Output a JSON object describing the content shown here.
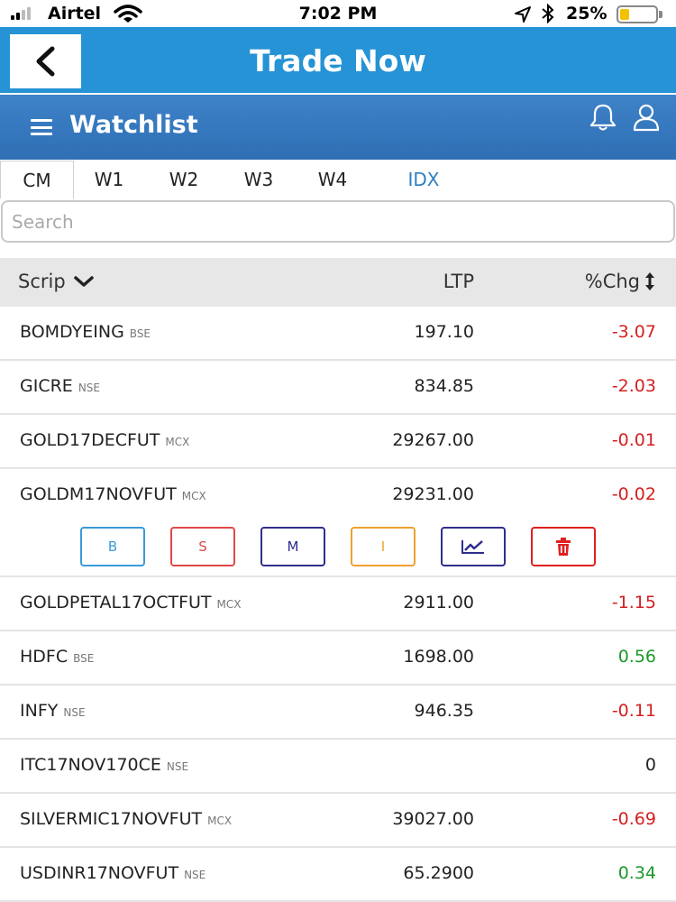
{
  "status_bar": {
    "carrier": "Airtel",
    "time": "7:02 PM",
    "battery": "25%",
    "battery_level": 0.25,
    "icons": [
      "signal-icon",
      "wifi-icon",
      "location-arrow-icon",
      "bluetooth-icon",
      "battery-icon"
    ]
  },
  "header": {
    "title": "Trade Now",
    "back_icon": "chevron-left-icon"
  },
  "watchlist_bar": {
    "title": "Watchlist",
    "icons": [
      "menu-icon",
      "bell-icon",
      "user-icon"
    ]
  },
  "tabs": [
    {
      "label": "CM",
      "active": true
    },
    {
      "label": "W1",
      "active": false
    },
    {
      "label": "W2",
      "active": false
    },
    {
      "label": "W3",
      "active": false
    },
    {
      "label": "W4",
      "active": false
    },
    {
      "label": "IDX",
      "active": false
    }
  ],
  "search": {
    "placeholder": "Search",
    "value": ""
  },
  "table": {
    "columns": {
      "scrip": "Scrip",
      "ltp": "LTP",
      "chg": "%Chg"
    },
    "rows": [
      {
        "scrip": "BOMDYEING",
        "exchange": "BSE",
        "ltp": "197.10",
        "chg": "-3.07"
      },
      {
        "scrip": "GICRE",
        "exchange": "NSE",
        "ltp": "834.85",
        "chg": "-2.03"
      },
      {
        "scrip": "GOLD17DECFUT",
        "exchange": "MCX",
        "ltp": "29267.00",
        "chg": "-0.01"
      },
      {
        "scrip": "GOLDM17NOVFUT",
        "exchange": "MCX",
        "ltp": "29231.00",
        "chg": "-0.02"
      },
      {
        "scrip": "GOLDPETAL17OCTFUT",
        "exchange": "MCX",
        "ltp": "2911.00",
        "chg": "-1.15"
      },
      {
        "scrip": "HDFC",
        "exchange": "BSE",
        "ltp": "1698.00",
        "chg": "0.56"
      },
      {
        "scrip": "INFY",
        "exchange": "NSE",
        "ltp": "946.35",
        "chg": "-0.11"
      },
      {
        "scrip": "ITC17NOV170CE",
        "exchange": "NSE",
        "ltp": "",
        "chg": "0"
      },
      {
        "scrip": "SILVERMIC17NOVFUT",
        "exchange": "MCX",
        "ltp": "39027.00",
        "chg": "-0.69"
      },
      {
        "scrip": "USDINR17NOVFUT",
        "exchange": "NSE",
        "ltp": "65.2900",
        "chg": "0.34"
      }
    ],
    "expanded_row_index": 3
  },
  "row_actions": [
    {
      "label": "B",
      "name": "buy-button",
      "color": "#3a9ad9"
    },
    {
      "label": "S",
      "name": "sell-button",
      "color": "#e04848"
    },
    {
      "label": "M",
      "name": "market-depth-button",
      "color": "#2e2e8c"
    },
    {
      "label": "I",
      "name": "info-button",
      "color": "#f0a030"
    },
    {
      "label": "",
      "name": "chart-button",
      "color": "#2e2e8c",
      "icon": "line-chart-icon"
    },
    {
      "label": "",
      "name": "delete-button",
      "color": "#e02020",
      "icon": "trash-icon"
    }
  ],
  "colors": {
    "header_blue": "#2593d5",
    "watchlist_blue": "#3377bf",
    "negative": "#d42020",
    "positive": "#1a9a2a",
    "neutral": "#222222"
  }
}
